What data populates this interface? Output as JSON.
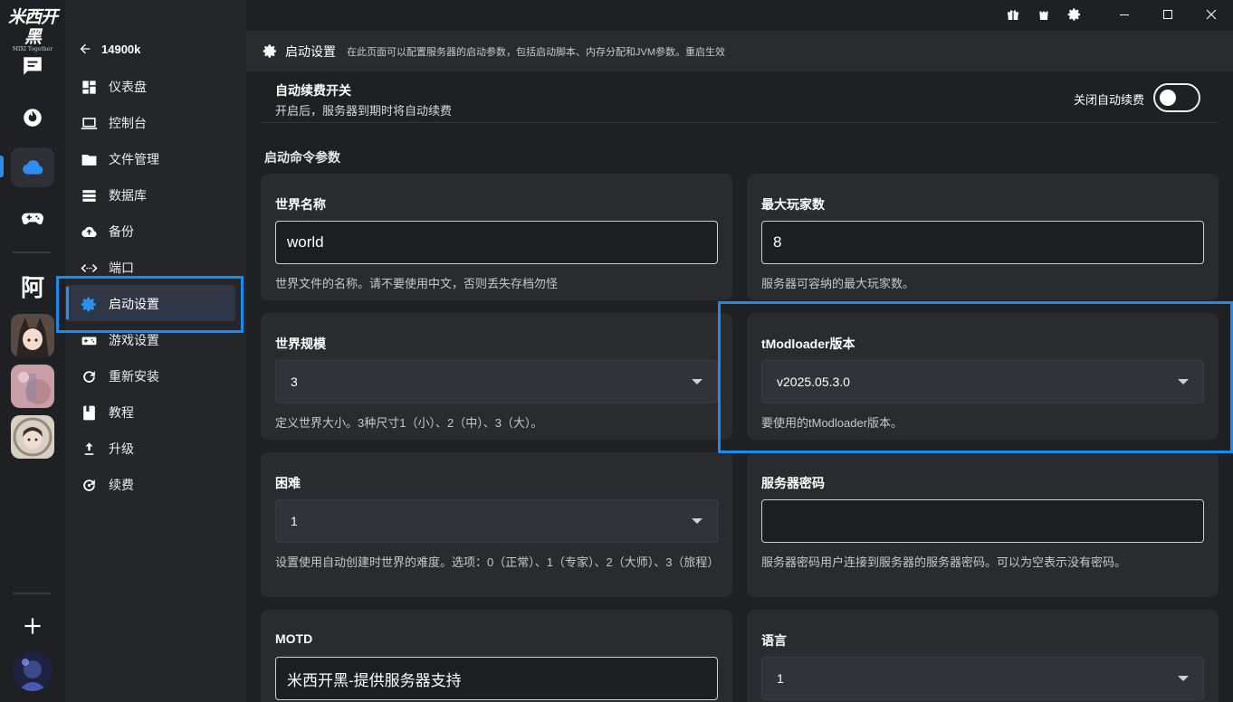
{
  "app": {
    "logo_text": "米西开黑",
    "logo_sub": "MIXI Together",
    "window_buttons": [
      "minimize",
      "maximize",
      "close"
    ],
    "titlebar_icons": [
      "gift-icon",
      "shopping-bag-icon",
      "gear-icon"
    ]
  },
  "rail": {
    "avatar_char": "阿",
    "items": [
      "chat-icon",
      "fire-icon",
      "cloud-icon",
      "gamepad-icon"
    ],
    "add_label": "+"
  },
  "sidebar": {
    "back_label": "14900k",
    "items": [
      {
        "label": "仪表盘",
        "icon": "dashboard-icon"
      },
      {
        "label": "控制台",
        "icon": "laptop-icon"
      },
      {
        "label": "文件管理",
        "icon": "folder-icon"
      },
      {
        "label": "数据库",
        "icon": "database-icon"
      },
      {
        "label": "备份",
        "icon": "cloud-upload-icon"
      },
      {
        "label": "端口",
        "icon": "code-arrows-icon"
      },
      {
        "label": "启动设置",
        "icon": "gear-icon",
        "active": true
      },
      {
        "label": "游戏设置",
        "icon": "gamepad-icon"
      },
      {
        "label": "重新安装",
        "icon": "refresh-icon"
      },
      {
        "label": "教程",
        "icon": "book-icon"
      },
      {
        "label": "升级",
        "icon": "upgrade-icon"
      },
      {
        "label": "续费",
        "icon": "renew-icon"
      }
    ]
  },
  "header": {
    "title": "启动设置",
    "description": "在此页面可以配置服务器的启动参数，包括启动脚本、内存分配和JVM参数。重启生效"
  },
  "renew": {
    "title": "自动续费开关",
    "description": "开启后，服务器到期时将自动续费",
    "toggle_label": "关闭自动续费",
    "toggle_on": false
  },
  "section_title": "启动命令参数",
  "fields": {
    "world_name": {
      "label": "世界名称",
      "value": "world",
      "help": "世界文件的名称。请不要使用中文，否则丢失存档勿怪"
    },
    "max_players": {
      "label": "最大玩家数",
      "value": "8",
      "help": "服务器可容纳的最大玩家数。"
    },
    "world_size": {
      "label": "世界规模",
      "value": "3",
      "help": "定义世界大小。3种尺寸1（小）、2（中）、3（大）。"
    },
    "tmod_version": {
      "label": "tModloader版本",
      "value": "v2025.05.3.0",
      "help": "要使用的tModloader版本。"
    },
    "difficulty": {
      "label": "困难",
      "value": "1",
      "help": "设置使用自动创建时世界的难度。选项：0（正常）、1（专家）、2（大师）、3（旅程）"
    },
    "server_password": {
      "label": "服务器密码",
      "value": "",
      "help": "服务器密码用户连接到服务器的服务器密码。可以为空表示没有密码。"
    },
    "motd": {
      "label": "MOTD",
      "value": "米西开黑-提供服务器支持"
    },
    "language": {
      "label": "语言",
      "value": "1"
    }
  },
  "colors": {
    "accent": "#2b8ff0",
    "highlight_box": "#1a8cf0",
    "background": "#1f2023",
    "card": "#2a2b2f"
  }
}
